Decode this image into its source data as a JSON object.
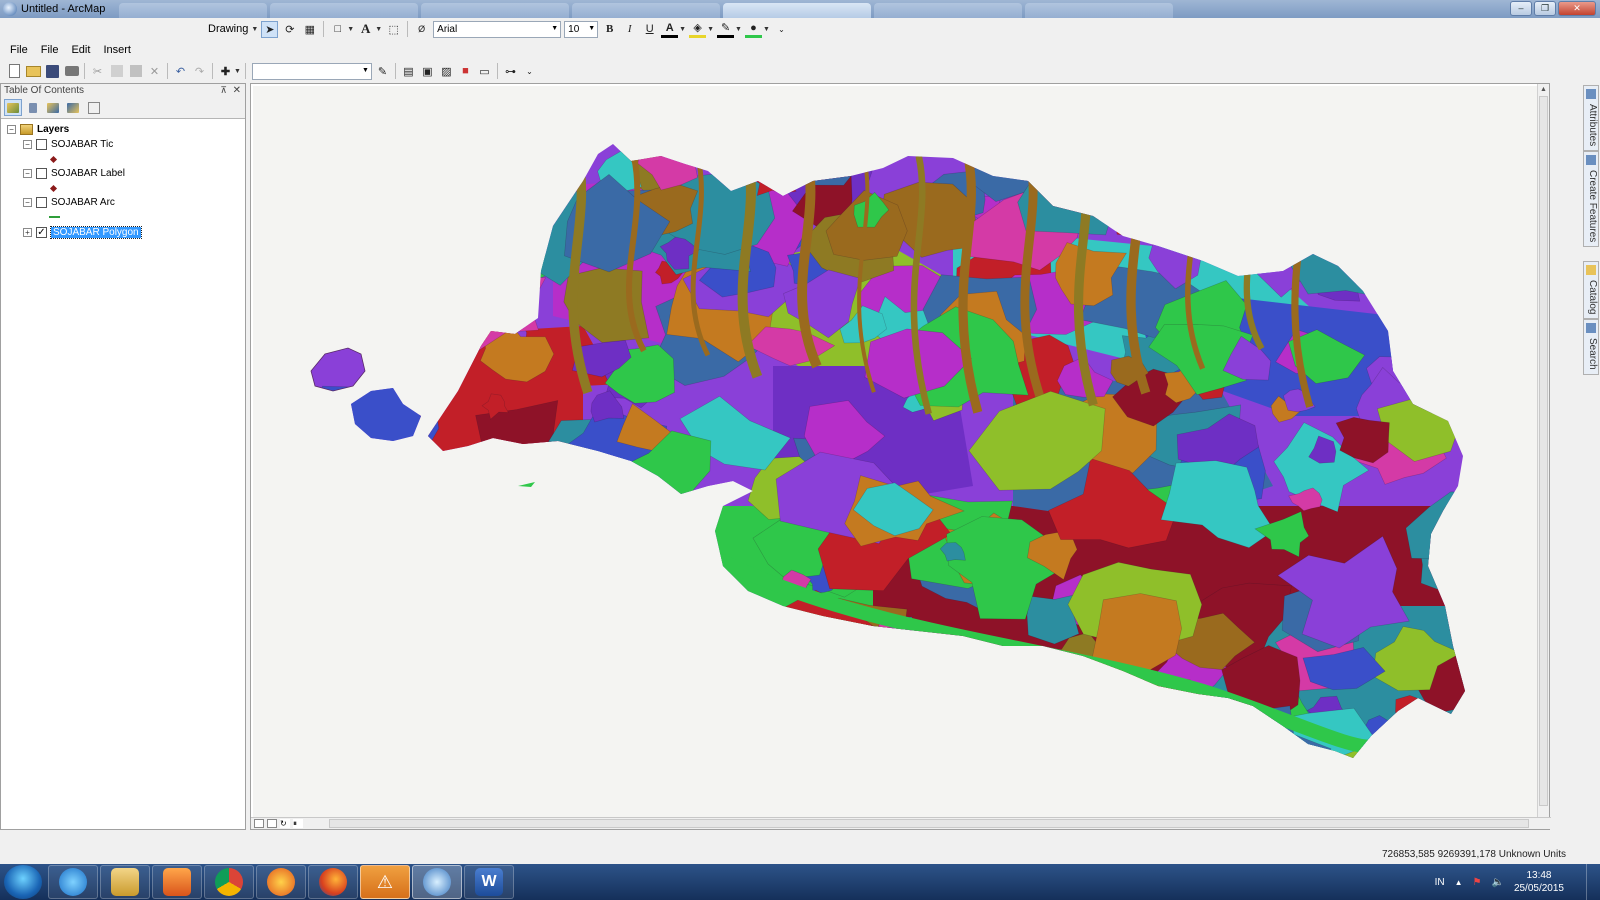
{
  "window": {
    "title": "Untitled - ArcMap"
  },
  "drawing_toolbar": {
    "label": "Drawing",
    "font_name": "Arial",
    "font_size": "10",
    "bold": "B",
    "italic": "I",
    "underline": "U",
    "text_tool": "A"
  },
  "menu": {
    "items": [
      "File",
      "File",
      "Edit",
      "Insert"
    ]
  },
  "toc": {
    "title": "Table Of Contents",
    "root_label": "Layers",
    "layers": [
      {
        "name": "SOJABAR Tic",
        "checked": false,
        "expander": "⊟"
      },
      {
        "name": "SOJABAR Label",
        "checked": false,
        "expander": "⊟"
      },
      {
        "name": "SOJABAR Arc",
        "checked": false,
        "expander": "⊟"
      },
      {
        "name": "SOJABAR Polygon",
        "checked": true,
        "expander": "⊞"
      }
    ]
  },
  "dock_tabs": [
    "Attributes",
    "Create Features",
    "Catalog",
    "Search"
  ],
  "status": {
    "coordinates": "726853,585  9269391,178 Unknown Units"
  },
  "taskbar": {
    "apps": [
      "internet-explorer",
      "file-explorer",
      "media-player",
      "chrome",
      "firefox-orange",
      "firefox",
      "arcmap-ext",
      "arcmap",
      "word"
    ],
    "tray_language": "IN",
    "time": "13:48",
    "date": "25/05/2015"
  },
  "colors": {
    "crimson": "#8e1228",
    "red": "#c21f28",
    "magenta": "#b62ec9",
    "purple": "#6e2fc4",
    "violet": "#8a40d8",
    "blue": "#3a4fc9",
    "steel": "#3a6aa6",
    "teal": "#2c8ea0",
    "cyan": "#35c7c2",
    "green": "#2fc74a",
    "lime": "#8fbf2a",
    "olive": "#8e7a23",
    "brown": "#9a6a1e",
    "orange": "#c47a20",
    "pink": "#d43aa6"
  }
}
